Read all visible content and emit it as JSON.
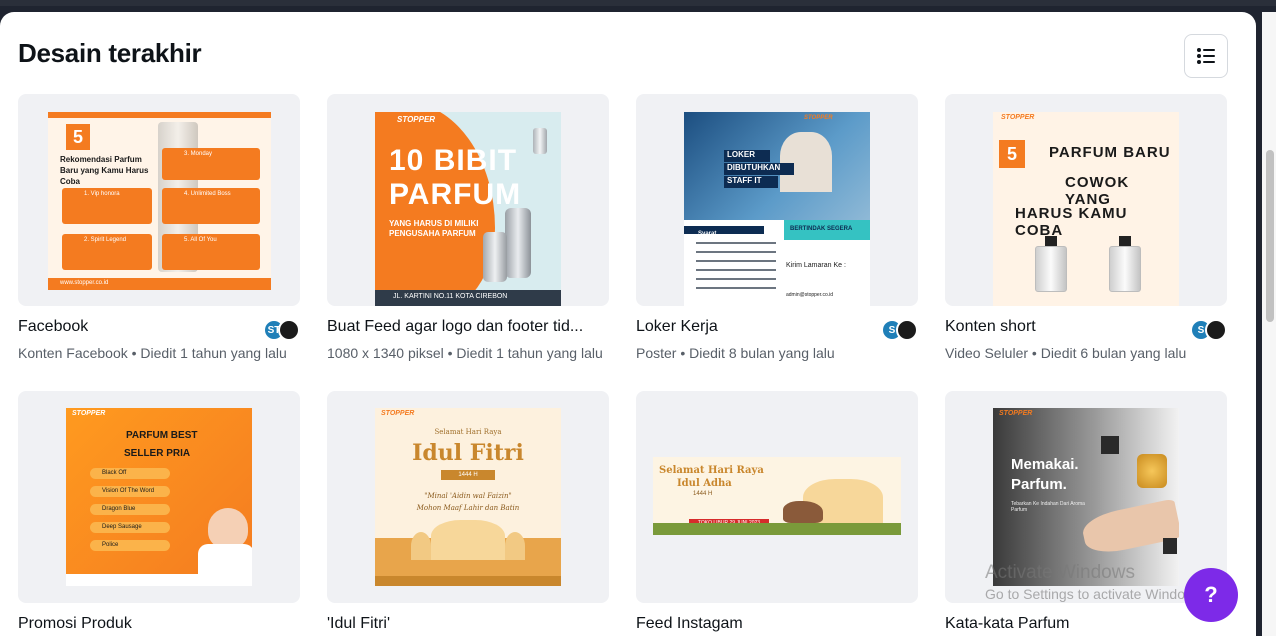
{
  "section": {
    "title": "Desain terakhir"
  },
  "designs": [
    {
      "name": "Facebook",
      "meta": "Konten Facebook • Diedit 1 tahun yang lalu",
      "avatar": "ST",
      "art": {
        "number": "5",
        "headline": "Rekomendasi Parfum Baru yang Kamu Harus Coba",
        "items": [
          "1. Vip honora",
          "2. Spirit Legend",
          "3. Monday",
          "4. Unlimited Boss",
          "5. All Of You"
        ],
        "footer": "www.stopper.co.id"
      }
    },
    {
      "name": "Buat Feed agar logo dan footer tid...",
      "meta": "1080 x 1340 piksel • Diedit 1 tahun yang lalu",
      "avatar": "",
      "art": {
        "brand": "STOPPER",
        "line1": "10 BIBIT",
        "line2": "PARFUM",
        "line3": "YANG HARUS DI MILIKI",
        "line4": "PENGUSAHA PARFUM",
        "footer": "JL. KARTINI NO.11 KOTA CIREBON"
      }
    },
    {
      "name": "Loker Kerja",
      "meta": "Poster • Diedit 8 bulan yang lalu",
      "avatar": "S",
      "art": {
        "brand": "STOPPER",
        "l1": "LOKER",
        "l2": "DIBUTUHKAN",
        "l3": "STAFF IT",
        "badge": "BERTINDAK SEGERA",
        "req": "Syarat",
        "send": "Kirim Lamaran Ke :",
        "email": "admin@stopper.co.id"
      }
    },
    {
      "name": "Konten short",
      "meta": "Video Seluler • Diedit 6 bulan yang lalu",
      "avatar": "S",
      "art": {
        "brand": "STOPPER",
        "number": "5",
        "l1": "PARFUM BARU",
        "l2": "COWOK YANG",
        "l3": "HARUS KAMU COBA"
      }
    },
    {
      "name": "Promosi Produk",
      "meta": "",
      "avatar": "",
      "art": {
        "brand": "STOPPER",
        "l1": "PARFUM BEST",
        "l2": "SELLER PRIA",
        "items": [
          "Black Off",
          "Vision Of The Word",
          "Dragon Blue",
          "Deep Sausage",
          "Police"
        ]
      }
    },
    {
      "name": "'Idul Fitri'",
      "meta": "",
      "avatar": "",
      "art": {
        "brand": "STOPPER",
        "l1": "Selamat Hari Raya",
        "l2": "Idul Fitri",
        "l3": "1444 H",
        "l4": "\"Minal 'Aidin wal Faizin\"",
        "l5": "Mohon Maaf Lahir dan Batin"
      }
    },
    {
      "name": "Feed Instagam",
      "meta": "",
      "avatar": "",
      "art": {
        "l1": "Selamat Hari Raya",
        "l2": "Idul Adha",
        "l3": "1444 H",
        "badge": "TOKO LIBUR 29 JUNI 2023"
      }
    },
    {
      "name": "Kata-kata Parfum",
      "meta": "",
      "avatar": "",
      "art": {
        "brand": "STOPPER",
        "l1": "Memakai.",
        "l2": "Parfum.",
        "l3": "Tebarkan Ke Indahan Dari Aroma Parfum"
      }
    }
  ],
  "help": {
    "label": "?"
  },
  "watermark": {
    "line1": "Activate Windows",
    "line2": "Go to Settings to activate Windows."
  },
  "colors": {
    "accent": "#7d2ae8",
    "orange": "#f47b20",
    "bg_card": "#f0f1f4"
  },
  "icons": {
    "view_toggle": "list-view-icon"
  }
}
